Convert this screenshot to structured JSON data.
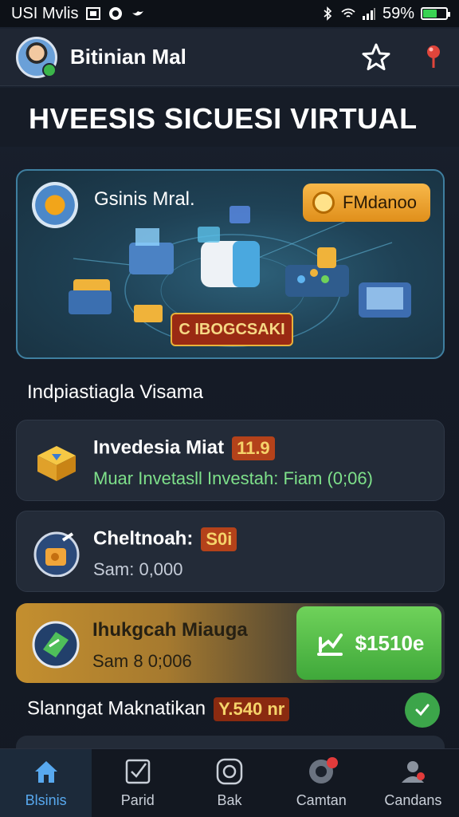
{
  "status_bar": {
    "left_text": "USI Mvlis",
    "battery": "59%",
    "battery_level": 0.59
  },
  "header": {
    "title": "Bitinian Mal",
    "star_icon": "star-icon",
    "pin_icon": "location-pin-icon"
  },
  "page": {
    "title": "HVEESIS SICUESI VIRTUAL"
  },
  "hero": {
    "title": "Gsinis Mral.",
    "button_label": "FMdanoo",
    "cta_label": "C IBOGCSAKI"
  },
  "section": {
    "label": "Indpiastiagla Visama"
  },
  "cards": [
    {
      "title": "Invedesia Miat",
      "badge": "11.9",
      "subtitle": "Muar Invetasll Investah: Fiam (0;06)"
    },
    {
      "title": "Cheltnoah:",
      "badge": "S0i",
      "subtitle": "Sam: 0,000"
    },
    {
      "title": "Ihukgcah Miauga",
      "subtitle": "Sam 8 0;006",
      "button_label": "$1510e"
    }
  ],
  "bottom_row": {
    "label": "Slanngat Maknatikan",
    "badge": "Y.540 nr"
  },
  "nav": [
    {
      "label": "Blsinis",
      "icon": "home-icon",
      "active": true
    },
    {
      "label": "Parid",
      "icon": "checkbox-icon",
      "active": false
    },
    {
      "label": "Bak",
      "icon": "camera-icon",
      "active": false
    },
    {
      "label": "Camtan",
      "icon": "record-icon",
      "active": false
    },
    {
      "label": "Candans",
      "icon": "profile-icon",
      "active": false
    }
  ],
  "colors": {
    "accent": "#58a9ef",
    "orange": "#f0a53a",
    "green": "#4fbe45",
    "badge": "#b4421a"
  }
}
